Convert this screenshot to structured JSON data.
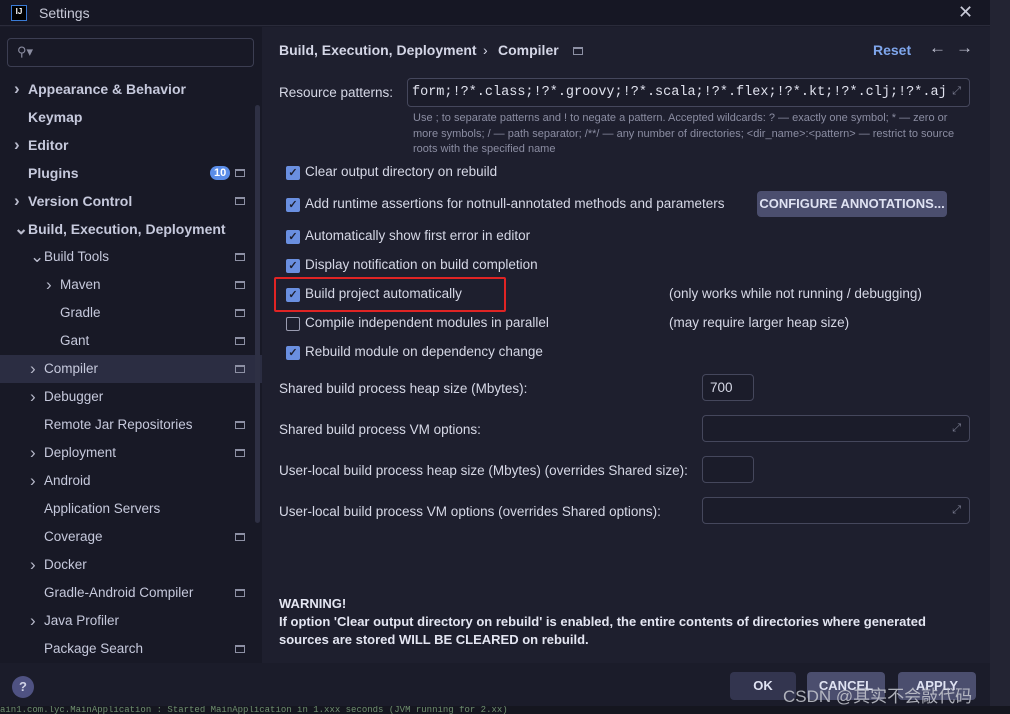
{
  "window": {
    "title": "Settings",
    "logo": "IJ"
  },
  "sidebar": {
    "search_placeholder": "",
    "items": [
      {
        "label": "Appearance & Behavior",
        "level": 0,
        "chevron": "right",
        "bold": true
      },
      {
        "label": "Keymap",
        "level": 0,
        "bold": true
      },
      {
        "label": "Editor",
        "level": 0,
        "chevron": "right",
        "bold": true
      },
      {
        "label": "Plugins",
        "level": 0,
        "bold": true,
        "badge": "10",
        "pin": true
      },
      {
        "label": "Version Control",
        "level": 0,
        "chevron": "right",
        "bold": true,
        "pin": true
      },
      {
        "label": "Build, Execution, Deployment",
        "level": 0,
        "chevron": "down",
        "bold": true
      },
      {
        "label": "Build Tools",
        "level": 1,
        "chevron": "down",
        "pin": true
      },
      {
        "label": "Maven",
        "level": 2,
        "chevron": "right",
        "pin": true
      },
      {
        "label": "Gradle",
        "level": 2,
        "pin": true
      },
      {
        "label": "Gant",
        "level": 2,
        "pin": true
      },
      {
        "label": "Compiler",
        "level": 1,
        "chevron": "right",
        "pin": true,
        "selected": true
      },
      {
        "label": "Debugger",
        "level": 1,
        "chevron": "right"
      },
      {
        "label": "Remote Jar Repositories",
        "level": 1,
        "pin": true
      },
      {
        "label": "Deployment",
        "level": 1,
        "chevron": "right",
        "pin": true
      },
      {
        "label": "Android",
        "level": 1,
        "chevron": "right"
      },
      {
        "label": "Application Servers",
        "level": 1
      },
      {
        "label": "Coverage",
        "level": 1,
        "pin": true
      },
      {
        "label": "Docker",
        "level": 1,
        "chevron": "right"
      },
      {
        "label": "Gradle-Android Compiler",
        "level": 1,
        "pin": true
      },
      {
        "label": "Java Profiler",
        "level": 1,
        "chevron": "right"
      },
      {
        "label": "Package Search",
        "level": 1,
        "pin": true
      }
    ]
  },
  "header": {
    "breadcrumb": [
      "Build, Execution, Deployment",
      "Compiler"
    ],
    "separator": "›",
    "reset": "Reset"
  },
  "resource": {
    "label": "Resource patterns:",
    "value": "form;!?*.class;!?*.groovy;!?*.scala;!?*.flex;!?*.kt;!?*.clj;!?*.aj",
    "hint": "Use ; to separate patterns and ! to negate a pattern. Accepted wildcards: ? — exactly one symbol; * — zero or more symbols; / — path separator; /**/ — any number of directories; <dir_name>:<pattern> — restrict to source roots with the specified name"
  },
  "options": [
    {
      "label": "Clear output directory on rebuild",
      "checked": true
    },
    {
      "label": "Add runtime assertions for notnull-annotated methods and parameters",
      "checked": true
    },
    {
      "label": "Automatically show first error in editor",
      "checked": true
    },
    {
      "label": "Display notification on build completion",
      "checked": true
    },
    {
      "label": "Build project automatically",
      "checked": true,
      "note": "(only works while not running / debugging)",
      "highlighted": true
    },
    {
      "label": "Compile independent modules in parallel",
      "checked": false,
      "note": "(may require larger heap size)"
    },
    {
      "label": "Rebuild module on dependency change",
      "checked": true
    }
  ],
  "configure_button": "CONFIGURE ANNOTATIONS...",
  "fields": [
    {
      "label": "Shared build process heap size (Mbytes):",
      "value": "700"
    },
    {
      "label": "Shared build process VM options:",
      "value": ""
    },
    {
      "label": "User-local build process heap size (Mbytes) (overrides Shared size):",
      "value": ""
    },
    {
      "label": "User-local build process VM options (overrides Shared options):",
      "value": ""
    }
  ],
  "warning": {
    "title": "WARNING!",
    "text": "If option 'Clear output directory on rebuild' is enabled, the entire contents of directories where generated sources are stored WILL BE CLEARED on rebuild."
  },
  "footer": {
    "help": "?",
    "ok": "OK",
    "cancel": "CANCEL",
    "apply": "APPLY"
  },
  "watermark": "CSDN @其实不会敲代码",
  "console": "ain1.com.lyc.MainApplication            : Started MainApplication in 1.xxx seconds (JVM running for 2.xx)",
  "colors": {
    "accent": "#6a8fe0",
    "highlight_box": "#e02424",
    "badge": "#5b8de8"
  }
}
